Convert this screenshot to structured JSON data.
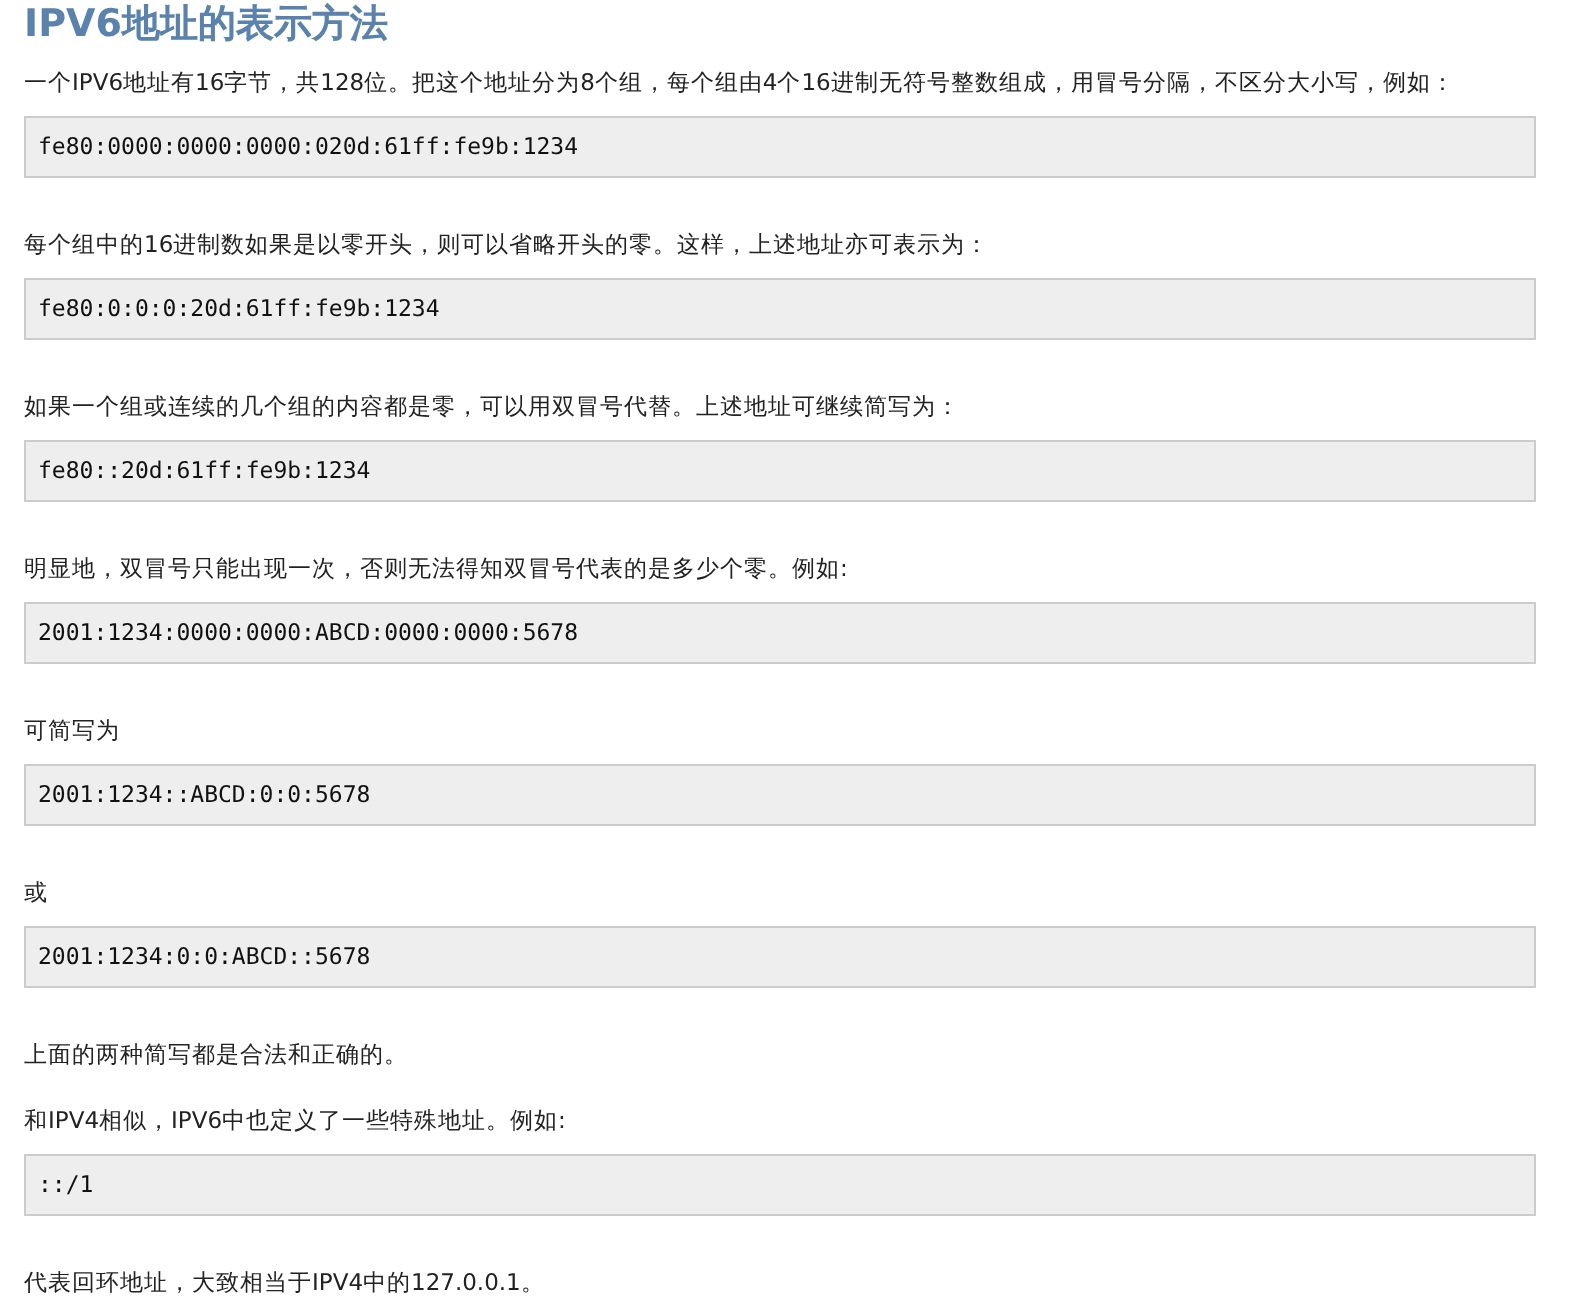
{
  "title": "IPV6地址的表示方法",
  "blocks": [
    {
      "kind": "paragraph",
      "text": "一个IPV6地址有16字节，共128位。把这个地址分为8个组，每个组由4个16进制无符号整数组成，用冒号分隔，不区分大小写，例如："
    },
    {
      "kind": "code",
      "text": "fe80:0000:0000:0000:020d:61ff:fe9b:1234"
    },
    {
      "kind": "paragraph",
      "text": "每个组中的16进制数如果是以零开头，则可以省略开头的零。这样，上述地址亦可表示为："
    },
    {
      "kind": "code",
      "text": "fe80:0:0:0:20d:61ff:fe9b:1234"
    },
    {
      "kind": "paragraph",
      "text": "如果一个组或连续的几个组的内容都是零，可以用双冒号代替。上述地址可继续简写为："
    },
    {
      "kind": "code",
      "text": "fe80::20d:61ff:fe9b:1234"
    },
    {
      "kind": "paragraph",
      "text": "明显地，双冒号只能出现一次，否则无法得知双冒号代表的是多少个零。例如:"
    },
    {
      "kind": "code",
      "text": "2001:1234:0000:0000:ABCD:0000:0000:5678"
    },
    {
      "kind": "paragraph",
      "text": "可简写为"
    },
    {
      "kind": "code",
      "text": "2001:1234::ABCD:0:0:5678"
    },
    {
      "kind": "paragraph",
      "text": "或"
    },
    {
      "kind": "code",
      "text": "2001:1234:0:0:ABCD::5678"
    },
    {
      "kind": "paragraph",
      "text": "上面的两种简写都是合法和正确的。"
    },
    {
      "kind": "paragraph",
      "text": "和IPV4相似，IPV6中也定义了一些特殊地址。例如:"
    },
    {
      "kind": "code",
      "text": "::/1"
    },
    {
      "kind": "paragraph",
      "text": "代表回环地址，大致相当于IPV4中的127.0.0.1。"
    }
  ]
}
